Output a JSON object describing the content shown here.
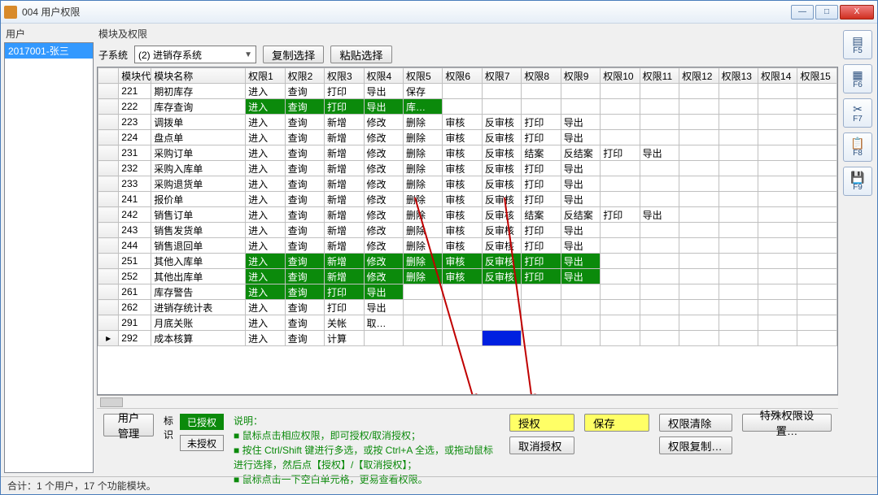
{
  "window": {
    "title": "004 用户权限"
  },
  "winbtns": {
    "min": "—",
    "max": "□",
    "close": "X"
  },
  "left": {
    "label": "用户",
    "users": [
      {
        "label": "2017001-张三",
        "selected": true
      }
    ]
  },
  "right_label": "模块及权限",
  "subsys": {
    "label": "子系统",
    "value": "(2) 进销存系统"
  },
  "toolbar_top": {
    "copy": "复制选择",
    "paste": "粘贴选择"
  },
  "grid": {
    "headers": [
      "模块代码",
      "模块名称",
      "权限1",
      "权限2",
      "权限3",
      "权限4",
      "权限5",
      "权限6",
      "权限7",
      "权限8",
      "权限9",
      "权限10",
      "权限11",
      "权限12",
      "权限13",
      "权限14",
      "权限15"
    ],
    "rows": [
      {
        "code": "221",
        "name": "期初库存",
        "cells": [
          {
            "t": "进入"
          },
          {
            "t": "查询"
          },
          {
            "t": "打印"
          },
          {
            "t": "导出"
          },
          {
            "t": "保存"
          },
          {
            "t": ""
          },
          {
            "t": ""
          },
          {
            "t": ""
          },
          {
            "t": ""
          },
          {
            "t": ""
          },
          {
            "t": ""
          },
          {
            "t": ""
          },
          {
            "t": ""
          },
          {
            "t": ""
          },
          {
            "t": ""
          }
        ]
      },
      {
        "code": "222",
        "name": "库存查询",
        "cells": [
          {
            "t": "进入",
            "g": 1
          },
          {
            "t": "查询",
            "g": 1
          },
          {
            "t": "打印",
            "g": 1
          },
          {
            "t": "导出",
            "g": 1
          },
          {
            "t": "库…",
            "g": 1
          },
          {
            "t": ""
          },
          {
            "t": ""
          },
          {
            "t": ""
          },
          {
            "t": ""
          },
          {
            "t": ""
          },
          {
            "t": ""
          },
          {
            "t": ""
          },
          {
            "t": ""
          },
          {
            "t": ""
          },
          {
            "t": ""
          }
        ]
      },
      {
        "code": "223",
        "name": "调拨单",
        "cells": [
          {
            "t": "进入"
          },
          {
            "t": "查询"
          },
          {
            "t": "新增"
          },
          {
            "t": "修改"
          },
          {
            "t": "删除"
          },
          {
            "t": "审核"
          },
          {
            "t": "反审核"
          },
          {
            "t": "打印"
          },
          {
            "t": "导出"
          },
          {
            "t": ""
          },
          {
            "t": ""
          },
          {
            "t": ""
          },
          {
            "t": ""
          },
          {
            "t": ""
          },
          {
            "t": ""
          }
        ]
      },
      {
        "code": "224",
        "name": "盘点单",
        "cells": [
          {
            "t": "进入"
          },
          {
            "t": "查询"
          },
          {
            "t": "新增"
          },
          {
            "t": "修改"
          },
          {
            "t": "删除"
          },
          {
            "t": "审核"
          },
          {
            "t": "反审核"
          },
          {
            "t": "打印"
          },
          {
            "t": "导出"
          },
          {
            "t": ""
          },
          {
            "t": ""
          },
          {
            "t": ""
          },
          {
            "t": ""
          },
          {
            "t": ""
          },
          {
            "t": ""
          }
        ]
      },
      {
        "code": "231",
        "name": "采购订单",
        "cells": [
          {
            "t": "进入"
          },
          {
            "t": "查询"
          },
          {
            "t": "新增"
          },
          {
            "t": "修改"
          },
          {
            "t": "删除"
          },
          {
            "t": "审核"
          },
          {
            "t": "反审核"
          },
          {
            "t": "结案"
          },
          {
            "t": "反结案"
          },
          {
            "t": "打印"
          },
          {
            "t": "导出"
          },
          {
            "t": ""
          },
          {
            "t": ""
          },
          {
            "t": ""
          },
          {
            "t": ""
          }
        ]
      },
      {
        "code": "232",
        "name": "采购入库单",
        "cells": [
          {
            "t": "进入"
          },
          {
            "t": "查询"
          },
          {
            "t": "新增"
          },
          {
            "t": "修改"
          },
          {
            "t": "删除"
          },
          {
            "t": "审核"
          },
          {
            "t": "反审核"
          },
          {
            "t": "打印"
          },
          {
            "t": "导出"
          },
          {
            "t": ""
          },
          {
            "t": ""
          },
          {
            "t": ""
          },
          {
            "t": ""
          },
          {
            "t": ""
          },
          {
            "t": ""
          }
        ]
      },
      {
        "code": "233",
        "name": "采购退货单",
        "cells": [
          {
            "t": "进入"
          },
          {
            "t": "查询"
          },
          {
            "t": "新增"
          },
          {
            "t": "修改"
          },
          {
            "t": "删除"
          },
          {
            "t": "审核"
          },
          {
            "t": "反审核"
          },
          {
            "t": "打印"
          },
          {
            "t": "导出"
          },
          {
            "t": ""
          },
          {
            "t": ""
          },
          {
            "t": ""
          },
          {
            "t": ""
          },
          {
            "t": ""
          },
          {
            "t": ""
          }
        ]
      },
      {
        "code": "241",
        "name": "报价单",
        "cells": [
          {
            "t": "进入"
          },
          {
            "t": "查询"
          },
          {
            "t": "新增"
          },
          {
            "t": "修改"
          },
          {
            "t": "删除"
          },
          {
            "t": "审核"
          },
          {
            "t": "反审核"
          },
          {
            "t": "打印"
          },
          {
            "t": "导出"
          },
          {
            "t": ""
          },
          {
            "t": ""
          },
          {
            "t": ""
          },
          {
            "t": ""
          },
          {
            "t": ""
          },
          {
            "t": ""
          }
        ]
      },
      {
        "code": "242",
        "name": "销售订单",
        "cells": [
          {
            "t": "进入"
          },
          {
            "t": "查询"
          },
          {
            "t": "新增"
          },
          {
            "t": "修改"
          },
          {
            "t": "删除"
          },
          {
            "t": "审核"
          },
          {
            "t": "反审核"
          },
          {
            "t": "结案"
          },
          {
            "t": "反结案"
          },
          {
            "t": "打印"
          },
          {
            "t": "导出"
          },
          {
            "t": ""
          },
          {
            "t": ""
          },
          {
            "t": ""
          },
          {
            "t": ""
          }
        ]
      },
      {
        "code": "243",
        "name": "销售发货单",
        "cells": [
          {
            "t": "进入"
          },
          {
            "t": "查询"
          },
          {
            "t": "新增"
          },
          {
            "t": "修改"
          },
          {
            "t": "删除"
          },
          {
            "t": "审核"
          },
          {
            "t": "反审核"
          },
          {
            "t": "打印"
          },
          {
            "t": "导出"
          },
          {
            "t": ""
          },
          {
            "t": ""
          },
          {
            "t": ""
          },
          {
            "t": ""
          },
          {
            "t": ""
          },
          {
            "t": ""
          }
        ]
      },
      {
        "code": "244",
        "name": "销售退回单",
        "cells": [
          {
            "t": "进入"
          },
          {
            "t": "查询"
          },
          {
            "t": "新增"
          },
          {
            "t": "修改"
          },
          {
            "t": "删除"
          },
          {
            "t": "审核"
          },
          {
            "t": "反审核"
          },
          {
            "t": "打印"
          },
          {
            "t": "导出"
          },
          {
            "t": ""
          },
          {
            "t": ""
          },
          {
            "t": ""
          },
          {
            "t": ""
          },
          {
            "t": ""
          },
          {
            "t": ""
          }
        ]
      },
      {
        "code": "251",
        "name": "其他入库单",
        "cells": [
          {
            "t": "进入",
            "g": 1
          },
          {
            "t": "查询",
            "g": 1
          },
          {
            "t": "新增",
            "g": 1
          },
          {
            "t": "修改",
            "g": 1
          },
          {
            "t": "删除",
            "g": 1
          },
          {
            "t": "审核",
            "g": 1
          },
          {
            "t": "反审核",
            "g": 1
          },
          {
            "t": "打印",
            "g": 1
          },
          {
            "t": "导出",
            "g": 1
          },
          {
            "t": ""
          },
          {
            "t": ""
          },
          {
            "t": ""
          },
          {
            "t": ""
          },
          {
            "t": ""
          },
          {
            "t": ""
          }
        ]
      },
      {
        "code": "252",
        "name": "其他出库单",
        "cells": [
          {
            "t": "进入",
            "g": 1
          },
          {
            "t": "查询",
            "g": 1
          },
          {
            "t": "新增",
            "g": 1
          },
          {
            "t": "修改",
            "g": 1
          },
          {
            "t": "删除",
            "g": 1
          },
          {
            "t": "审核",
            "g": 1
          },
          {
            "t": "反审核",
            "g": 1
          },
          {
            "t": "打印",
            "g": 1
          },
          {
            "t": "导出",
            "g": 1
          },
          {
            "t": ""
          },
          {
            "t": ""
          },
          {
            "t": ""
          },
          {
            "t": ""
          },
          {
            "t": ""
          },
          {
            "t": ""
          }
        ]
      },
      {
        "code": "261",
        "name": "库存警告",
        "cells": [
          {
            "t": "进入",
            "g": 1
          },
          {
            "t": "查询",
            "g": 1
          },
          {
            "t": "打印",
            "g": 1
          },
          {
            "t": "导出",
            "g": 1
          },
          {
            "t": ""
          },
          {
            "t": ""
          },
          {
            "t": ""
          },
          {
            "t": ""
          },
          {
            "t": ""
          },
          {
            "t": ""
          },
          {
            "t": ""
          },
          {
            "t": ""
          },
          {
            "t": ""
          },
          {
            "t": ""
          },
          {
            "t": ""
          }
        ]
      },
      {
        "code": "262",
        "name": "进销存统计表",
        "cells": [
          {
            "t": "进入"
          },
          {
            "t": "查询"
          },
          {
            "t": "打印"
          },
          {
            "t": "导出"
          },
          {
            "t": ""
          },
          {
            "t": ""
          },
          {
            "t": ""
          },
          {
            "t": ""
          },
          {
            "t": ""
          },
          {
            "t": ""
          },
          {
            "t": ""
          },
          {
            "t": ""
          },
          {
            "t": ""
          },
          {
            "t": ""
          },
          {
            "t": ""
          }
        ]
      },
      {
        "code": "291",
        "name": "月底关账",
        "cells": [
          {
            "t": "进入"
          },
          {
            "t": "查询"
          },
          {
            "t": "关帐"
          },
          {
            "t": "取…"
          },
          {
            "t": ""
          },
          {
            "t": ""
          },
          {
            "t": ""
          },
          {
            "t": ""
          },
          {
            "t": ""
          },
          {
            "t": ""
          },
          {
            "t": ""
          },
          {
            "t": ""
          },
          {
            "t": ""
          },
          {
            "t": ""
          },
          {
            "t": ""
          }
        ]
      },
      {
        "code": "292",
        "name": "成本核算",
        "marker": "▸",
        "cells": [
          {
            "t": "进入"
          },
          {
            "t": "查询"
          },
          {
            "t": "计算"
          },
          {
            "t": ""
          },
          {
            "t": ""
          },
          {
            "t": ""
          },
          {
            "t": "",
            "b": 1
          },
          {
            "t": ""
          },
          {
            "t": ""
          },
          {
            "t": ""
          },
          {
            "t": ""
          },
          {
            "t": ""
          },
          {
            "t": ""
          },
          {
            "t": ""
          },
          {
            "t": ""
          }
        ]
      }
    ]
  },
  "legend": {
    "label": "标识",
    "authorized": "已授权",
    "unauthorized": "未授权"
  },
  "desc": {
    "label": "说明：",
    "lines": [
      "鼠标点击相应权限，即可授权/取消授权；",
      "按住 Ctrl/Shift 键进行多选，或按 Ctrl+A 全选，或拖动鼠标进行选择，然后点【授权】/【取消授权】；",
      "鼠标点击一下空白单元格，更易查看权限。"
    ]
  },
  "buttons": {
    "user_mgmt": "用户管理",
    "authorize": "授权",
    "unauthorize": "取消授权",
    "save": "保存",
    "clear_perm": "权限清除",
    "copy_perm": "权限复制…",
    "special": "特殊权限设置…"
  },
  "sidebar": [
    {
      "key": "F5",
      "icon": "▤"
    },
    {
      "key": "F6",
      "icon": "▦"
    },
    {
      "key": "F7",
      "icon": "✂"
    },
    {
      "key": "F8",
      "icon": "📋"
    },
    {
      "key": "F9",
      "icon": "💾"
    }
  ],
  "status": "合计：1 个用户，17 个功能模块。"
}
